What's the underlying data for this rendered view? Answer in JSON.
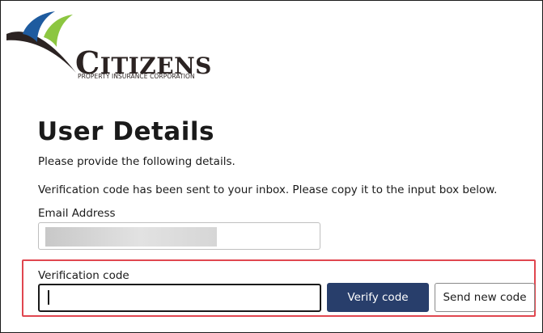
{
  "brand": {
    "name_first": "C",
    "name_rest": "ITIZENS",
    "tagline": "PROPERTY INSURANCE CORPORATION",
    "colors": {
      "blue": "#1e5b9f",
      "green": "#8cc641",
      "dark": "#2b2322"
    }
  },
  "page": {
    "title": "User Details",
    "instructions": "Please provide the following details.",
    "notice": "Verification code has been sent to your inbox. Please copy it to the input box below."
  },
  "email": {
    "label": "Email Address",
    "value": ""
  },
  "verification": {
    "label": "Verification code",
    "value": "",
    "highlight_color": "#e0464f"
  },
  "buttons": {
    "verify": "Verify code",
    "send_new": "Send new code",
    "verify_color": "#283e6b"
  }
}
